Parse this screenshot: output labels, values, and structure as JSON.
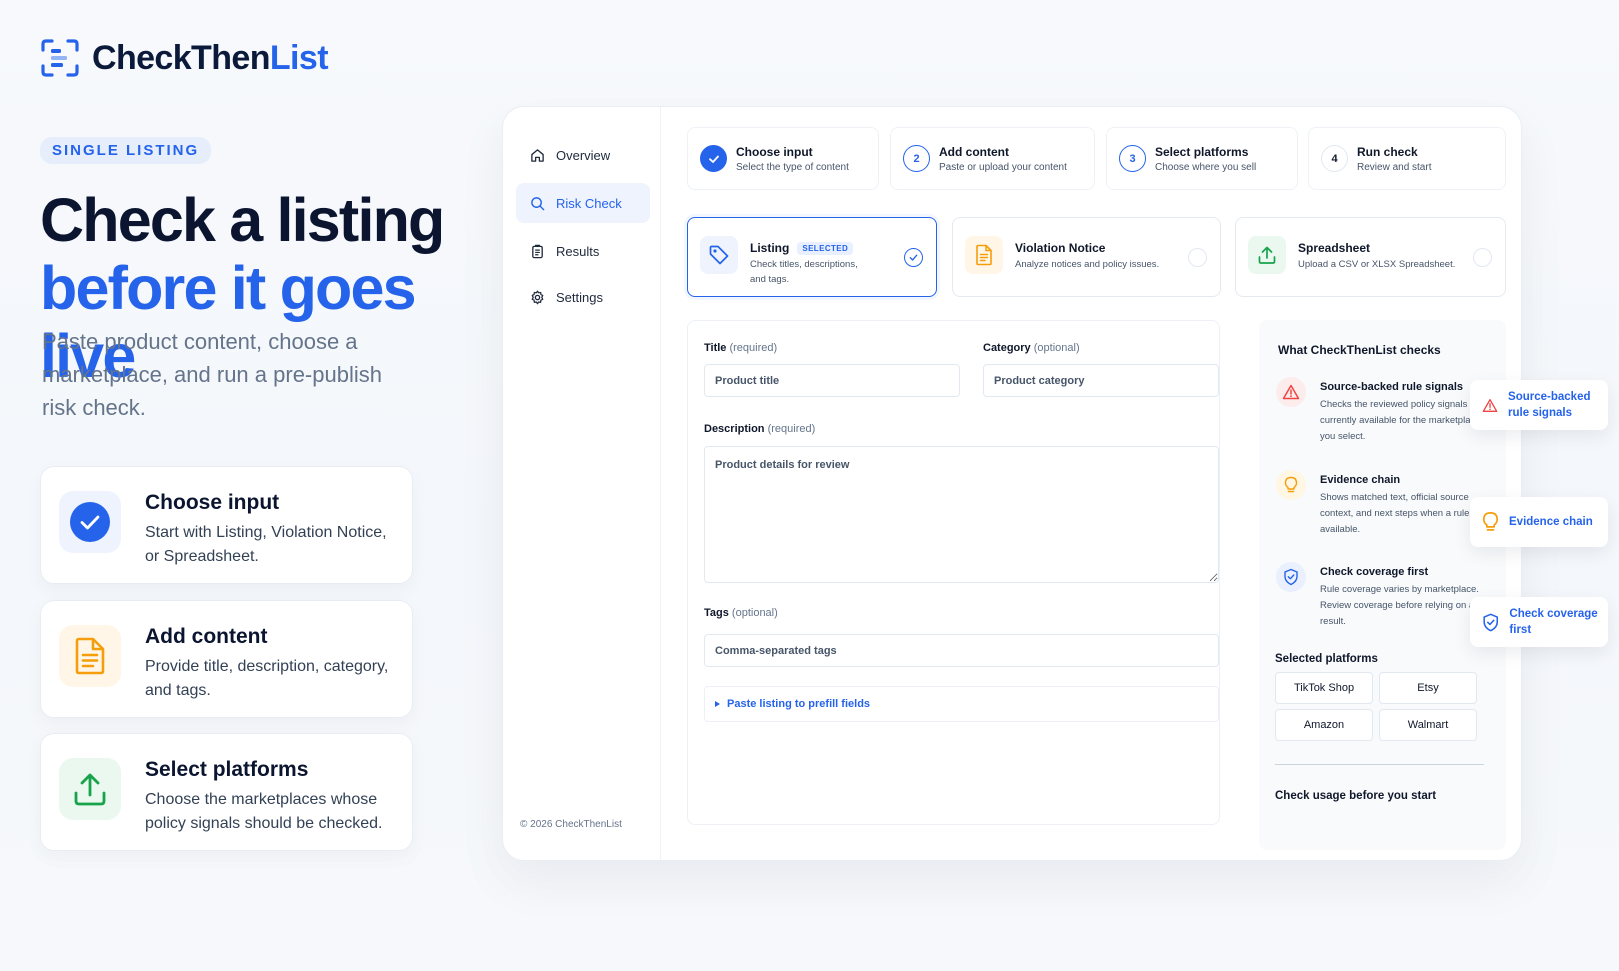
{
  "brand": {
    "name_main": "CheckThen",
    "name_accent": "List"
  },
  "hero": {
    "eyebrow": "SINGLE LISTING",
    "title_line1": "Check a listing",
    "title_line2": "before it goes live",
    "subtitle": "Paste product content, choose a marketplace, and run a pre-publish risk check."
  },
  "steps_overview": [
    {
      "title": "Choose input",
      "desc": "Start with Listing, Violation Notice, or Spreadsheet.",
      "icon": "check-circle-icon"
    },
    {
      "title": "Add content",
      "desc": "Provide title, description, category, and tags.",
      "icon": "document-icon"
    },
    {
      "title": "Select platforms",
      "desc": "Choose the marketplaces whose policy signals should be checked.",
      "icon": "upload-icon"
    }
  ],
  "sidebar": {
    "items": [
      {
        "label": "Overview",
        "icon": "home-icon"
      },
      {
        "label": "Risk Check",
        "icon": "search-icon",
        "active": true
      },
      {
        "label": "Results",
        "icon": "clipboard-icon"
      },
      {
        "label": "Settings",
        "icon": "gear-icon"
      }
    ],
    "copyright": "© 2026 CheckThenList"
  },
  "stepper": [
    {
      "num": "",
      "title": "Choose input",
      "sub": "Select the type of content",
      "state": "done"
    },
    {
      "num": "2",
      "title": "Add content",
      "sub": "Paste or upload your content",
      "state": "current"
    },
    {
      "num": "3",
      "title": "Select platforms",
      "sub": "Choose where you sell",
      "state": "upcoming"
    },
    {
      "num": "4",
      "title": "Run check",
      "sub": "Review and start",
      "state": "upcoming"
    }
  ],
  "input_types": [
    {
      "title": "Listing",
      "badge": "SELECTED",
      "desc": "Check titles, descriptions, and tags.",
      "selected": true
    },
    {
      "title": "Violation Notice",
      "desc": "Analyze notices and policy issues.",
      "selected": false
    },
    {
      "title": "Spreadsheet",
      "desc": "Upload a CSV or XLSX Spreadsheet.",
      "selected": false
    }
  ],
  "form": {
    "title_label": "Title",
    "title_hint": "(required)",
    "title_placeholder": "Product title",
    "title_value": "",
    "category_label": "Category",
    "category_hint": "(optional)",
    "category_placeholder": "Product category",
    "category_value": "",
    "description_label": "Description",
    "description_hint": "(required)",
    "description_placeholder": "Product details for review",
    "description_value": "",
    "tags_label": "Tags",
    "tags_hint": "(optional)",
    "tags_placeholder": "Comma-separated tags",
    "tags_value": "",
    "prefill_label": "Paste listing to prefill fields"
  },
  "info_panel": {
    "heading": "What CheckThenList checks",
    "checks": [
      {
        "title": "Source-backed rule signals",
        "desc": "Checks the reviewed policy signals currently available for the marketplaces you select.",
        "icon": "warning-icon",
        "color": "#ef4444"
      },
      {
        "title": "Evidence chain",
        "desc": "Shows matched text, official source context, and next steps when a rule is available.",
        "icon": "lightbulb-icon",
        "color": "#f59e0b"
      },
      {
        "title": "Check coverage first",
        "desc": "Rule coverage varies by marketplace. Review coverage before relying on a result.",
        "icon": "shield-check-icon",
        "color": "#2563eb"
      }
    ],
    "platforms_heading": "Selected platforms",
    "platforms": [
      "TikTok Shop",
      "Etsy",
      "Amazon",
      "Walmart"
    ],
    "usage_heading": "Check usage before you start"
  },
  "callouts": [
    {
      "label": "Source-backed rule signals",
      "icon": "warning-icon"
    },
    {
      "label": "Evidence chain",
      "icon": "lightbulb-icon"
    },
    {
      "label": "Check coverage first",
      "icon": "shield-check-icon"
    }
  ],
  "colors": {
    "accent": "#2563eb",
    "text": "#0f172a",
    "muted": "#64748b"
  }
}
